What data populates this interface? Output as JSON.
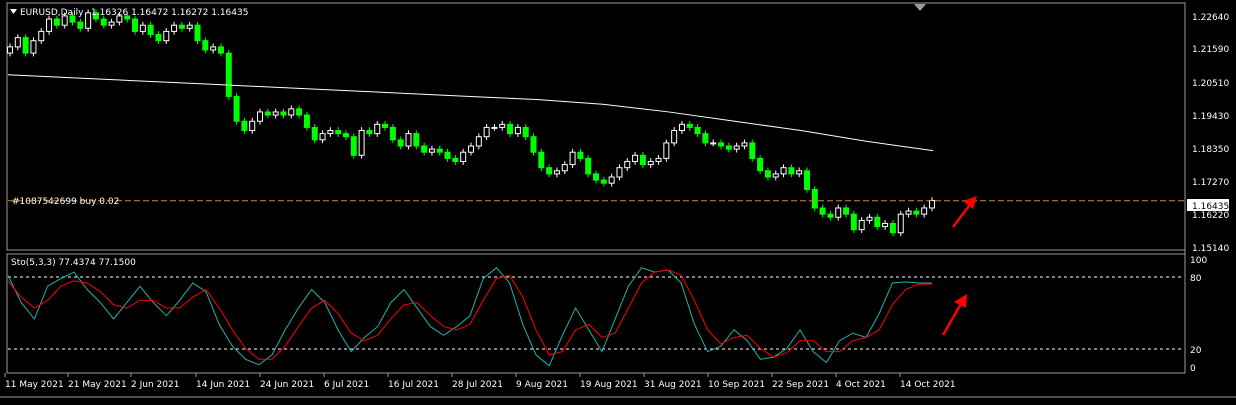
{
  "header": {
    "symbol_label": "EURUSD,Daily",
    "ohlc_label": "1.16326 1.16472 1.16272 1.16435"
  },
  "order_label": "#1087542699 buy 0.02",
  "price_scale_ticks": [
    "1.22640",
    "1.21590",
    "1.20510",
    "1.19430",
    "1.18350",
    "1.17270",
    "1.16220",
    "1.15140"
  ],
  "current_price_label": "1.16435",
  "stoch": {
    "label": "Sto(5,3,3) 77.4374 77.1500",
    "scale_ticks": [
      "100",
      "80",
      "20",
      "0"
    ]
  },
  "date_labels": [
    "11 May 2021",
    "21 May 2021",
    "2 Jun 2021",
    "14 Jun 2021",
    "24 Jun 2021",
    "6 Jul 2021",
    "16 Jul 2021",
    "28 Jul 2021",
    "9 Aug 2021",
    "19 Aug 2021",
    "31 Aug 2021",
    "10 Sep 2021",
    "22 Sep 2021",
    "4 Oct 2021",
    "14 Oct 2021"
  ],
  "colors": {
    "background": "#000000",
    "bull": "#ffffff",
    "bear": "#00ff00",
    "ma": "#ffffff",
    "stoch_main": "#20b2aa",
    "stoch_signal": "#ff0000",
    "level_line": "#cd853f",
    "arrow": "#ff0000"
  },
  "chart_data": [
    {
      "type": "candlestick",
      "symbol": "EURUSD",
      "timeframe": "Daily",
      "ylim": [
        1.1494,
        1.2272
      ],
      "x_dates": [
        "11 May 2021",
        "21 May 2021",
        "2 Jun 2021",
        "14 Jun 2021",
        "24 Jun 2021",
        "6 Jul 2021",
        "16 Jul 2021",
        "28 Jul 2021",
        "9 Aug 2021",
        "19 Aug 2021",
        "31 Aug 2021",
        "10 Sep 2021",
        "22 Sep 2021",
        "4 Oct 2021",
        "14 Oct 2021"
      ],
      "last": {
        "open": 1.16326,
        "high": 1.16472,
        "low": 1.16272,
        "close": 1.16435
      },
      "order_level": 1.16435,
      "closes": [
        1.214,
        1.217,
        1.212,
        1.216,
        1.219,
        1.223,
        1.221,
        1.224,
        1.222,
        1.22,
        1.225,
        1.223,
        1.221,
        1.222,
        1.224,
        1.223,
        1.219,
        1.221,
        1.218,
        1.216,
        1.219,
        1.221,
        1.22,
        1.221,
        1.216,
        1.213,
        1.214,
        1.212,
        1.198,
        1.19,
        1.187,
        1.19,
        1.193,
        1.192,
        1.193,
        1.192,
        1.194,
        1.192,
        1.188,
        1.184,
        1.186,
        1.187,
        1.186,
        1.185,
        1.179,
        1.187,
        1.186,
        1.189,
        1.188,
        1.184,
        1.182,
        1.186,
        1.182,
        1.18,
        1.181,
        1.18,
        1.178,
        1.177,
        1.18,
        1.182,
        1.185,
        1.188,
        1.188,
        1.189,
        1.186,
        1.188,
        1.185,
        1.18,
        1.175,
        1.173,
        1.174,
        1.176,
        1.18,
        1.178,
        1.173,
        1.171,
        1.17,
        1.172,
        1.175,
        1.177,
        1.179,
        1.176,
        1.177,
        1.178,
        1.183,
        1.187,
        1.189,
        1.188,
        1.186,
        1.183,
        1.183,
        1.182,
        1.181,
        1.182,
        1.183,
        1.178,
        1.174,
        1.172,
        1.173,
        1.175,
        1.173,
        1.174,
        1.168,
        1.162,
        1.16,
        1.159,
        1.162,
        1.16,
        1.155,
        1.158,
        1.159,
        1.156,
        1.157,
        1.154,
        1.16,
        1.161,
        1.16,
        1.162,
        1.1644
      ],
      "ma": [
        1.205,
        1.204,
        1.203,
        1.202,
        1.201,
        1.2,
        1.199,
        1.198,
        1.197,
        1.1955,
        1.193,
        1.19,
        1.187,
        1.1835,
        1.1805
      ],
      "stochastic": {
        "name": "Sto(5,3,3)",
        "main_last": 77.4374,
        "signal_last": 77.15,
        "levels": [
          80,
          20
        ],
        "ylim": [
          0,
          100
        ],
        "main": [
          85,
          60,
          45,
          75,
          82,
          88,
          72,
          60,
          45,
          60,
          75,
          60,
          48,
          62,
          78,
          70,
          40,
          20,
          8,
          3,
          12,
          35,
          55,
          72,
          60,
          35,
          15,
          28,
          38,
          60,
          72,
          55,
          38,
          30,
          38,
          48,
          82,
          92,
          78,
          40,
          12,
          2,
          30,
          55,
          35,
          15,
          45,
          75,
          92,
          88,
          90,
          78,
          40,
          15,
          20,
          35,
          25,
          8,
          10,
          18,
          35,
          15,
          5,
          25,
          32,
          28,
          50,
          78,
          79,
          78,
          78
        ],
        "signal": [
          80,
          65,
          55,
          62,
          75,
          80,
          78,
          70,
          58,
          55,
          62,
          62,
          55,
          55,
          65,
          72,
          55,
          35,
          18,
          8,
          8,
          20,
          38,
          55,
          62,
          50,
          32,
          25,
          30,
          45,
          58,
          60,
          48,
          38,
          35,
          40,
          62,
          82,
          85,
          65,
          35,
          12,
          15,
          35,
          40,
          28,
          32,
          55,
          78,
          88,
          90,
          85,
          62,
          35,
          22,
          28,
          30,
          18,
          10,
          14,
          25,
          25,
          15,
          15,
          25,
          28,
          35,
          58,
          72,
          77,
          77
        ]
      }
    }
  ]
}
